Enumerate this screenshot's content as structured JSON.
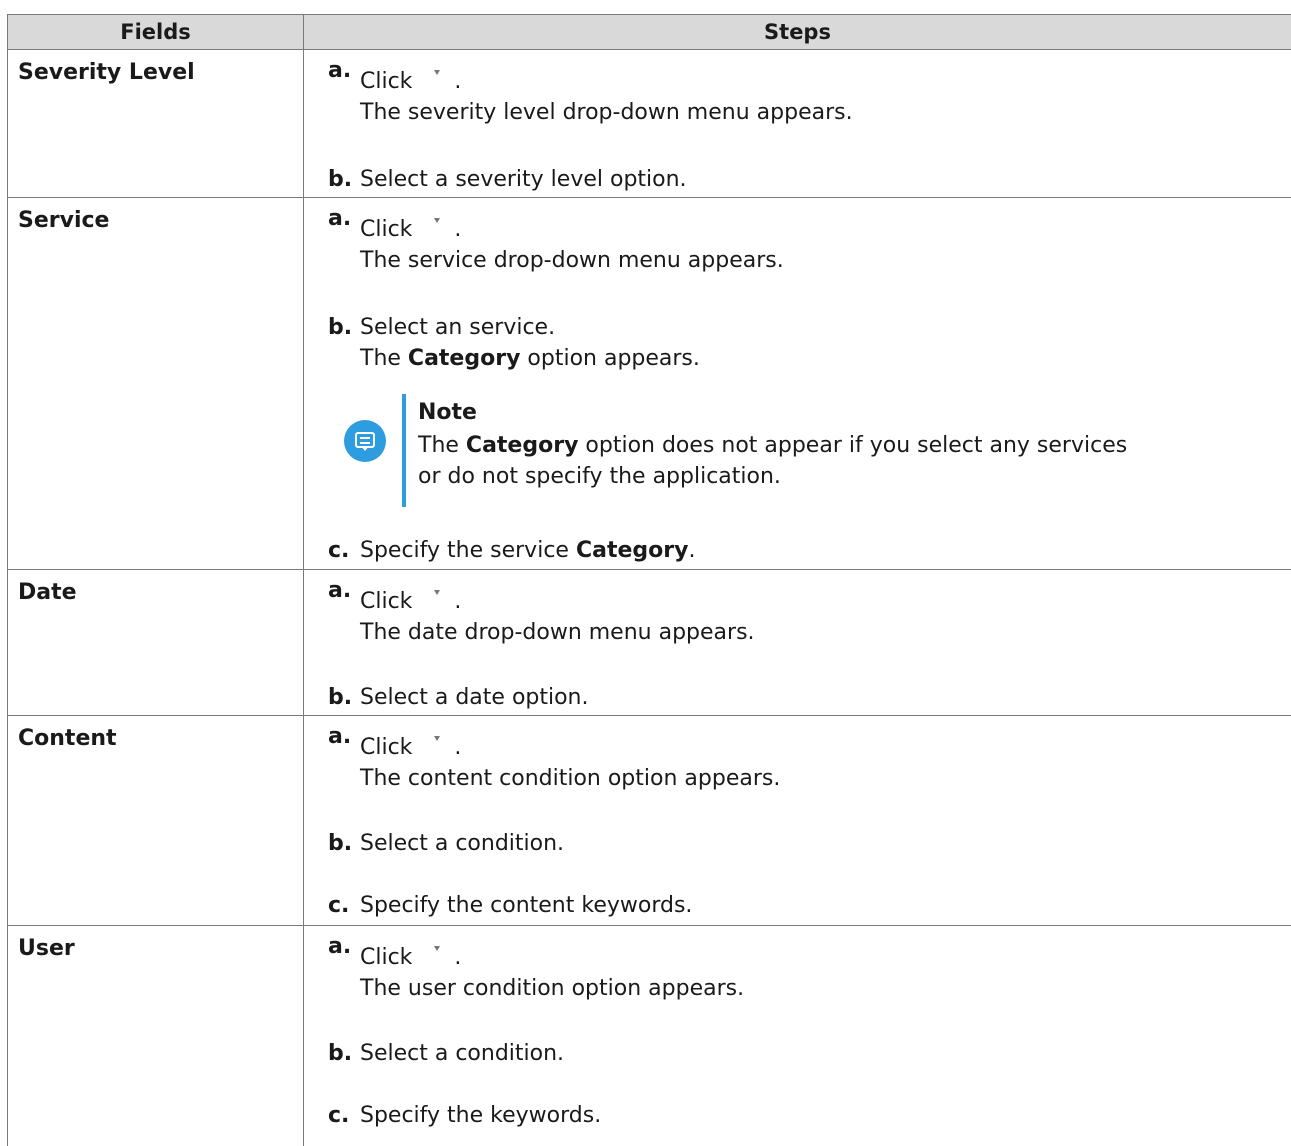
{
  "header": {
    "fields": "Fields",
    "steps": "Steps"
  },
  "rows": [
    {
      "field": "Severity Level",
      "steps": [
        {
          "marker": "a.",
          "prefix": "Click",
          "suffix": ".",
          "sub": "The severity level drop-down menu appears."
        },
        {
          "marker": "b.",
          "text": "Select a severity level option."
        }
      ]
    },
    {
      "field": "Service",
      "steps": [
        {
          "marker": "a.",
          "prefix": "Click",
          "suffix": ".",
          "sub": "The service drop-down menu appears."
        },
        {
          "marker": "b.",
          "text": "Select an service.",
          "sub_pre": "The ",
          "sub_bold": "Category",
          "sub_post": " option appears."
        },
        {
          "marker": "c.",
          "pre": "Specify the service ",
          "bold": "Category",
          "post": "."
        }
      ],
      "note": {
        "title": "Note",
        "pre": "The ",
        "bold": "Category",
        "post": " option does not appear if you select any services",
        "line2": "or do not specify the application."
      }
    },
    {
      "field": "Date",
      "steps": [
        {
          "marker": "a.",
          "prefix": "Click",
          "suffix": ".",
          "sub": "The date drop-down menu appears."
        },
        {
          "marker": "b.",
          "text": "Select a date option."
        }
      ]
    },
    {
      "field": "Content",
      "steps": [
        {
          "marker": "a.",
          "prefix": "Click",
          "suffix": ".",
          "sub": "The content condition option appears."
        },
        {
          "marker": "b.",
          "text": "Select a condition."
        },
        {
          "marker": "c.",
          "text": "Specify the content keywords."
        }
      ]
    },
    {
      "field": "User",
      "steps": [
        {
          "marker": "a.",
          "prefix": "Click",
          "suffix": ".",
          "sub": "The user condition option appears."
        },
        {
          "marker": "b.",
          "text": "Select a condition."
        },
        {
          "marker": "c.",
          "text": "Specify the keywords."
        }
      ]
    }
  ],
  "icons": {
    "dropdown": "dropdown-caret-icon",
    "note": "note-speech-bubble-icon"
  },
  "colors": {
    "header_bg": "#d9d9d9",
    "note_accent": "#2d9de0",
    "border": "#7a7a7a"
  }
}
